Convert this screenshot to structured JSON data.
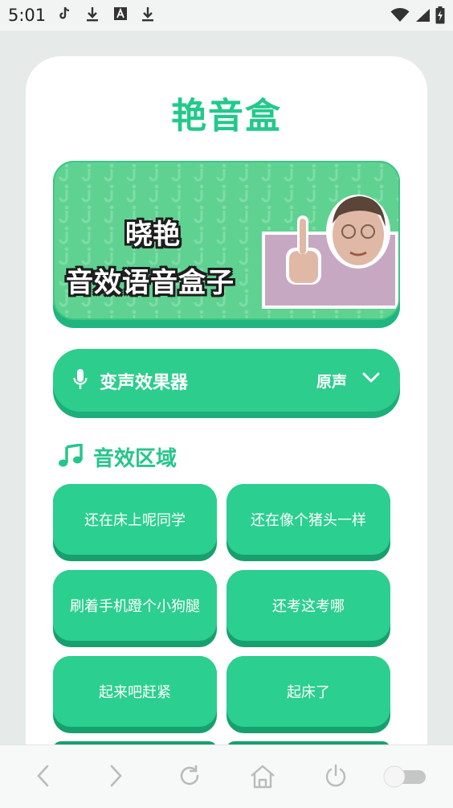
{
  "status_bar": {
    "time": "5:01",
    "icons": [
      "tiktok-icon",
      "download-icon",
      "app-a-icon",
      "download-icon",
      "wifi-icon",
      "signal-icon",
      "battery-charging-icon"
    ]
  },
  "app": {
    "title": "艳音盒",
    "banner": {
      "line1": "晓艳",
      "line2": "音效语音盒子"
    },
    "voice_changer": {
      "label": "变声效果器",
      "value": "原声"
    },
    "sounds_section": {
      "title": "音效区域",
      "items": [
        "还在床上呢同学",
        "还在像个猪头一样",
        "刷着手机蹬个小狗腿",
        "还考这考哪",
        "起来吧赶紧",
        "起床了"
      ]
    }
  },
  "colors": {
    "brand_green": "#22c98b",
    "button_green": "#2bcf8f",
    "button_shadow": "#17a06e"
  },
  "nav_bar": {
    "icons": [
      "back-icon",
      "forward-icon",
      "reload-icon",
      "home-icon",
      "power-icon",
      "toggle-switch"
    ]
  }
}
